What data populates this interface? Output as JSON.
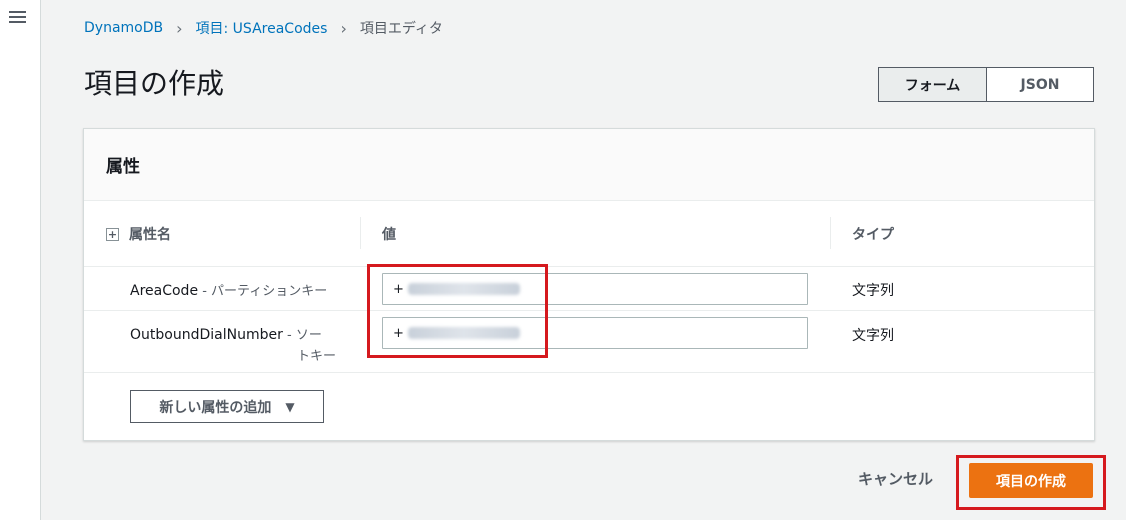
{
  "breadcrumb": {
    "items": [
      "DynamoDB",
      "項目: USAreaCodes"
    ],
    "current": "項目エディタ"
  },
  "page_title": "項目の作成",
  "view_toggle": {
    "form": "フォーム",
    "json": "JSON"
  },
  "panel": {
    "title": "属性",
    "columns": {
      "name": "属性名",
      "value": "値",
      "type": "タイプ"
    },
    "expand_glyph": "+",
    "rows": [
      {
        "name": "AreaCode",
        "key_type": " - パーティションキー",
        "value_prefix": "+",
        "type": "文字列"
      },
      {
        "name": "OutboundDialNumber",
        "key_type_1": " - ソー",
        "key_type_2": "トキー",
        "value_prefix": "+",
        "type": "文字列"
      }
    ],
    "add_attribute": "新しい属性の追加",
    "add_caret": "▼"
  },
  "footer": {
    "cancel": "キャンセル",
    "create": "項目の作成"
  },
  "colors": {
    "primary": "#ec7211",
    "link": "#0073bb",
    "highlight": "#d5191e"
  },
  "icons": {
    "menu": "hamburger-icon",
    "expand": "plus-square-icon",
    "caret": "caret-down-icon",
    "separator": "chevron-right-icon"
  }
}
